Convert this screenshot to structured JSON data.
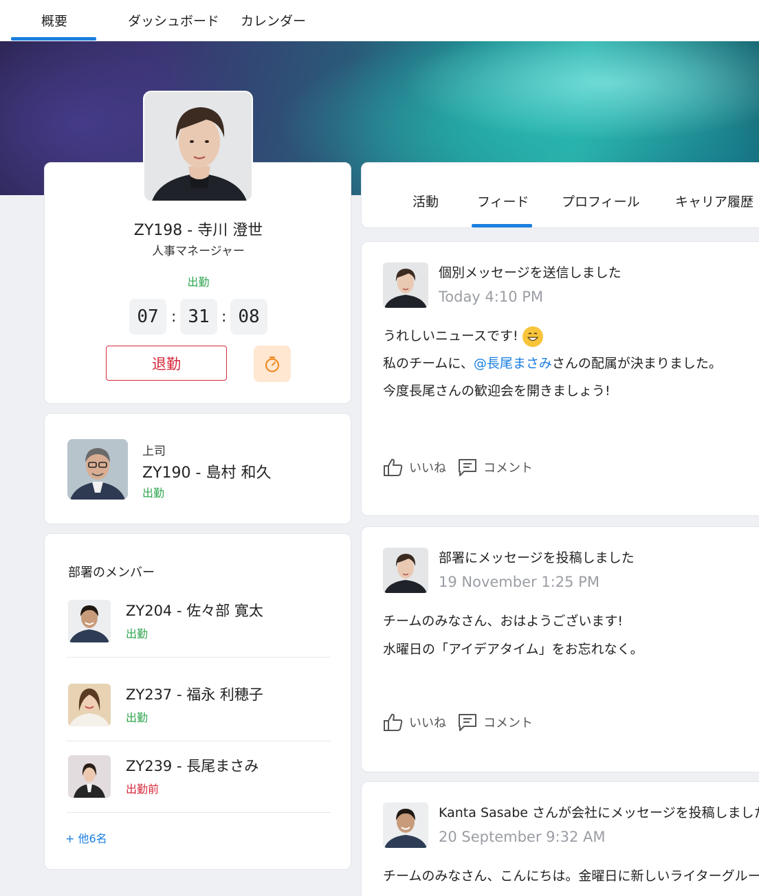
{
  "top_nav": {
    "tabs": [
      "概要",
      "ダッシュボード",
      "カレンダー"
    ],
    "active": "概要"
  },
  "profile": {
    "id": "ZY198",
    "name": "寺川 澄世",
    "title": "人事マネージャー",
    "status": "出勤",
    "timer": {
      "hours": "07",
      "minutes": "31",
      "seconds": "08"
    },
    "checkout_label": "退勤",
    "timer_button_icon": "stopwatch-icon"
  },
  "manager": {
    "label": "上司",
    "id": "ZY190",
    "name": "島村 和久",
    "status": "出勤"
  },
  "members": {
    "title": "部署のメンバー",
    "items": [
      {
        "id": "ZY204",
        "name": "佐々部 寛太",
        "status": "出勤",
        "status_color": "#2ea44f"
      },
      {
        "id": "ZY237",
        "name": "福永 利穂子",
        "status": "出勤",
        "status_color": "#2ea44f"
      },
      {
        "id": "ZY239",
        "name": "長尾まさみ",
        "status": "出勤前",
        "status_color": "#d6283a"
      }
    ],
    "more_label": "+ 他6名"
  },
  "right_tabs": {
    "tabs": [
      "活動",
      "フィード",
      "プロフィール",
      "キャリア履歴"
    ],
    "active": "フィード"
  },
  "posts": [
    {
      "title": "個別メッセージを送信しました",
      "time": "Today 4:10 PM",
      "line1": "うれしいニュースです!",
      "line2_prefix": "私のチームに、",
      "line2_mention": "@長尾まさみ",
      "line2_suffix": "さんの配属が決まりました。",
      "line3": "今度長尾さんの歓迎会を開きましょう!",
      "like_label": "いいね",
      "comment_label": "コメント"
    },
    {
      "title": "部署にメッセージを投稿しました",
      "time": "19 November 1:25 PM",
      "line1": "チームのみなさん、おはようございます!",
      "line2": "水曜日の「アイデアタイム」をお忘れなく。",
      "like_label": "いいね",
      "comment_label": "コメント"
    },
    {
      "title": "Kanta Sasabe さんが会社にメッセージを投稿しました",
      "time": "20 September 9:32 AM",
      "line1": "チームのみなさん、こんにちは。金曜日に新しいライターグループ"
    }
  ],
  "colors": {
    "accent": "#1a7fe0",
    "status_in": "#2ea44f",
    "status_out": "#d6283a",
    "timer_button_bg": "#ffe7d2",
    "timer_button_icon": "#f08a24"
  }
}
